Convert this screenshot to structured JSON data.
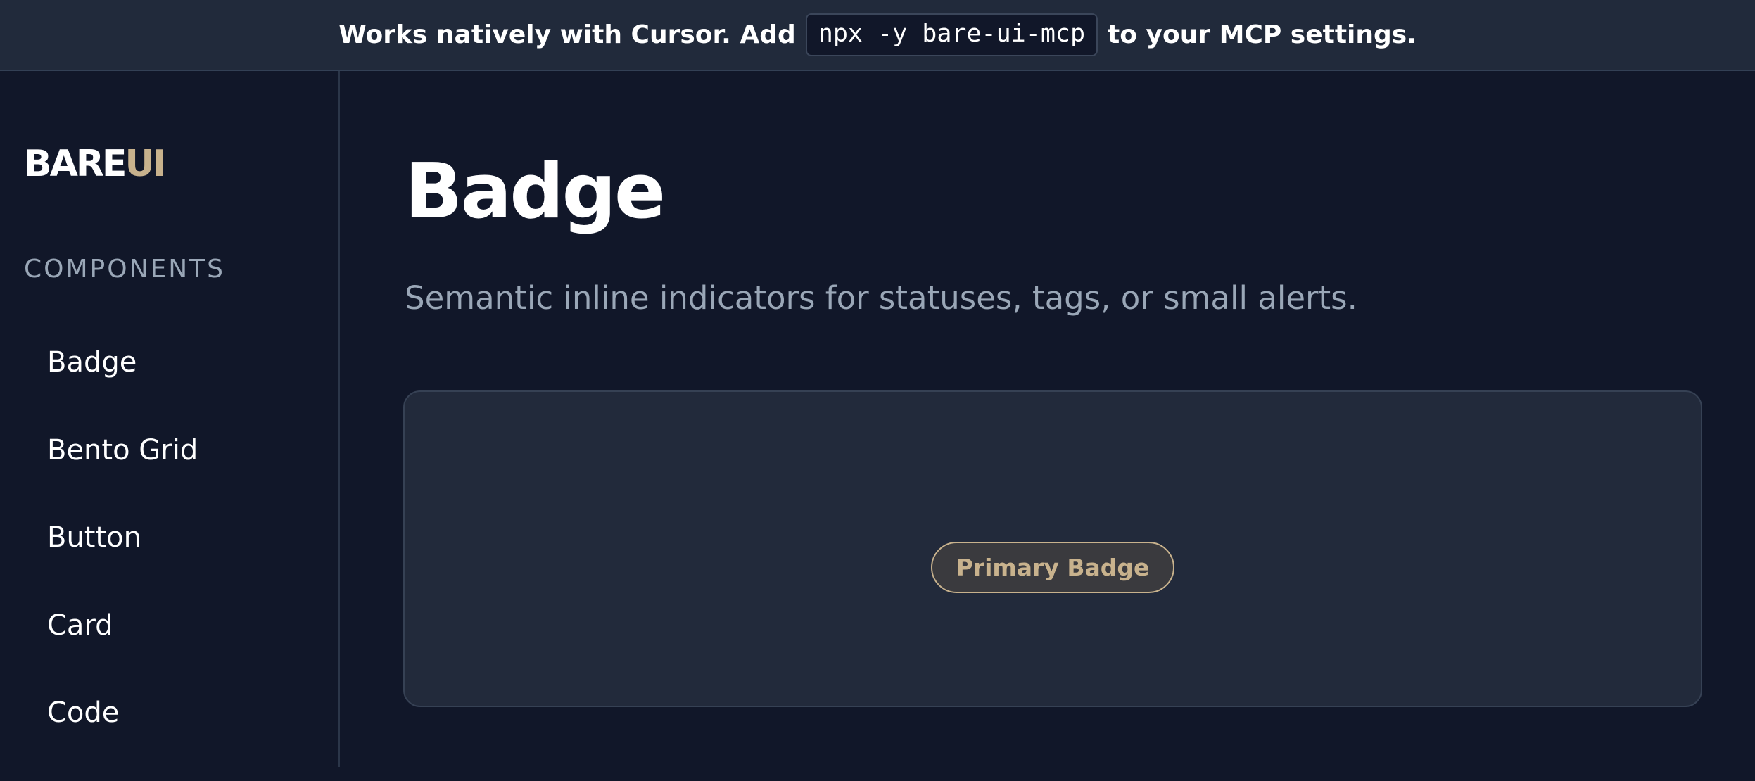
{
  "banner": {
    "before_text": "Works natively with Cursor. Add",
    "code": "npx -y bare-ui-mcp",
    "after_text": "to your MCP settings."
  },
  "sidebar": {
    "brand": {
      "part1": "BARE",
      "part2": "UI",
      "accent_color": "#c8b28d"
    },
    "section_title": "COMPONENTS",
    "items": [
      {
        "label": "Badge"
      },
      {
        "label": "Bento Grid"
      },
      {
        "label": "Button"
      },
      {
        "label": "Card"
      },
      {
        "label": "Code"
      }
    ]
  },
  "main": {
    "title": "Badge",
    "subtitle": "Semantic inline indicators for statuses, tags, or small alerts.",
    "preview": {
      "badge_label": "Primary Badge"
    }
  },
  "colors": {
    "background": "#111729",
    "banner_background": "#212a3b",
    "panel_background": "#222a3b",
    "accent": "#c8b28d",
    "muted_text": "#9aa7b7"
  }
}
